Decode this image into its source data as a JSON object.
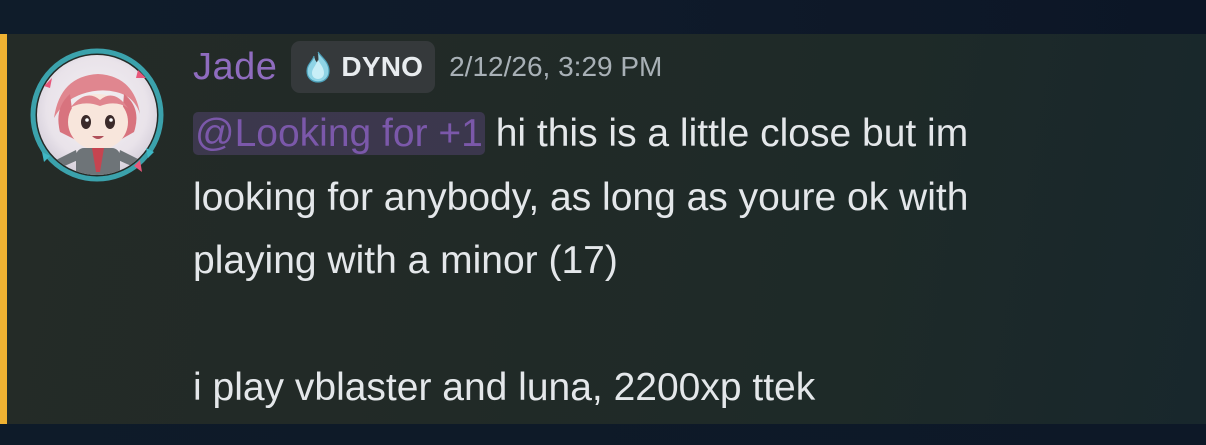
{
  "message": {
    "author": "Jade",
    "tag_label": "DYNO",
    "timestamp": "2/12/26, 3:29 PM",
    "mention": "@Looking for +1",
    "text_after_mention": " hi this is a little close but im\nlooking for anybody, as long as youre ok with\nplaying with a minor (17)\n\ni play vblaster and luna, 2200xp ttek"
  },
  "colors": {
    "highlight_bar": "#f0b232",
    "username": "#8f6cbf",
    "mention": "#7b58aa"
  },
  "icons": {
    "tag_icon": "flame-gem-icon"
  }
}
